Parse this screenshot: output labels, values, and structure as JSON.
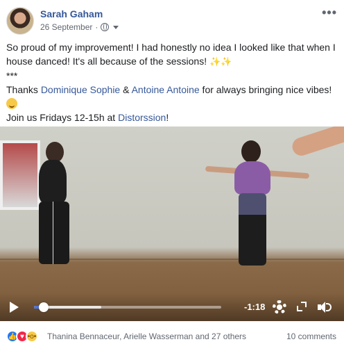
{
  "post": {
    "author": "Sarah Gaham",
    "date": "26 September",
    "separator": "·",
    "more_icon": "more-options-icon",
    "privacy_icon": "globe-icon",
    "text": {
      "line1": "So proud of my improvement! I had honestly no idea I looked like that when I house danced! It's all because of the sessions!",
      "sparkles": "✨✨",
      "divider": "***",
      "thanks_prefix": "Thanks ",
      "mention1": "Dominique Sophie",
      "amp": " & ",
      "mention2": "Antoine Antoine",
      "thanks_suffix": " for always bringing nice vibes!",
      "join_prefix": "Join us Fridays 12-15h at ",
      "page_link": "Distorssion",
      "join_suffix": "!"
    }
  },
  "video": {
    "time_remaining": "-1:18",
    "progress": 0.05,
    "buffered": 0.36
  },
  "footer": {
    "reactions": [
      "like",
      "love",
      "wow"
    ],
    "reaction_names": "Thanina Bennaceur, Arielle Wasserman and 27 others",
    "comments": "10 comments"
  },
  "colors": {
    "link": "#365899",
    "progress": "#4b75e0",
    "like": "#2078f4",
    "love": "#f0284a",
    "wow": "#f7c948"
  }
}
